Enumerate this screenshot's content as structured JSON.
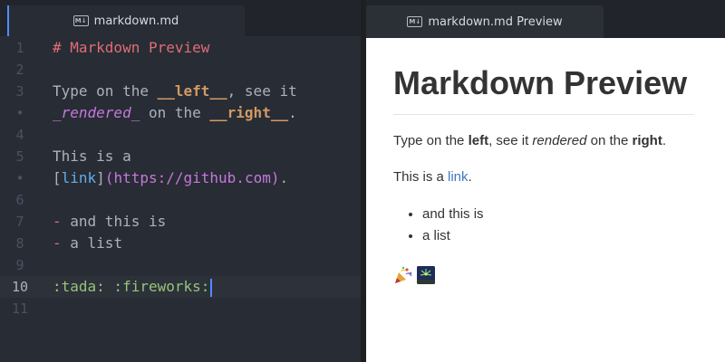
{
  "editor": {
    "tab_title": "markdown.md",
    "tab_icon": "markdown-icon",
    "icon_label": "M↓",
    "lines": [
      {
        "number": "1",
        "segments": [
          {
            "t": "# Markdown Preview",
            "c": "c-heading"
          }
        ]
      },
      {
        "number": "2",
        "segments": []
      },
      {
        "number": "3",
        "segments": [
          {
            "t": "Type on the ",
            "c": ""
          },
          {
            "t": "__left__",
            "c": "c-bold"
          },
          {
            "t": ", see it",
            "c": ""
          }
        ]
      },
      {
        "number": "•",
        "segments": [
          {
            "t": "_rendered_",
            "c": "c-italic"
          },
          {
            "t": " on the ",
            "c": ""
          },
          {
            "t": "__right__",
            "c": "c-bold"
          },
          {
            "t": ".",
            "c": ""
          }
        ]
      },
      {
        "number": "4",
        "segments": []
      },
      {
        "number": "5",
        "segments": [
          {
            "t": "This is a",
            "c": ""
          }
        ]
      },
      {
        "number": "•",
        "segments": [
          {
            "t": "[",
            "c": "c-punct"
          },
          {
            "t": "link",
            "c": "c-link"
          },
          {
            "t": "]",
            "c": "c-punct"
          },
          {
            "t": "(https://github.com)",
            "c": "c-url"
          },
          {
            "t": ".",
            "c": ""
          }
        ]
      },
      {
        "number": "6",
        "segments": []
      },
      {
        "number": "7",
        "segments": [
          {
            "t": "-",
            "c": "c-list"
          },
          {
            "t": " and this is",
            "c": ""
          }
        ]
      },
      {
        "number": "8",
        "segments": [
          {
            "t": "-",
            "c": "c-list"
          },
          {
            "t": " a list",
            "c": ""
          }
        ]
      },
      {
        "number": "9",
        "segments": []
      },
      {
        "number": "10",
        "segments": [
          {
            "t": ":tada: :fireworks:",
            "c": "c-emoji"
          }
        ],
        "current": true
      },
      {
        "number": "11",
        "segments": []
      }
    ]
  },
  "preview": {
    "tab_title": "markdown.md Preview",
    "tab_icon": "markdown-icon",
    "icon_label": "M↓",
    "title": "Markdown Preview",
    "para1": {
      "a": "Type on the ",
      "b": "left",
      "c": ", see it ",
      "d": "rendered",
      "e": " on the ",
      "f": "right",
      "g": "."
    },
    "para2": {
      "a": "This is a ",
      "link": "link",
      "b": "."
    },
    "list": [
      "and this is",
      "a list"
    ],
    "emojis": [
      "tada-emoji",
      "fireworks-emoji"
    ]
  },
  "colors": {
    "editor_bg": "#282c34",
    "heading": "#e06c75",
    "bold": "#d19a66",
    "italic": "#c678dd",
    "link": "#61afef",
    "emoji_code": "#98c379",
    "cursor": "#528bff",
    "preview_link": "#4078c0"
  }
}
